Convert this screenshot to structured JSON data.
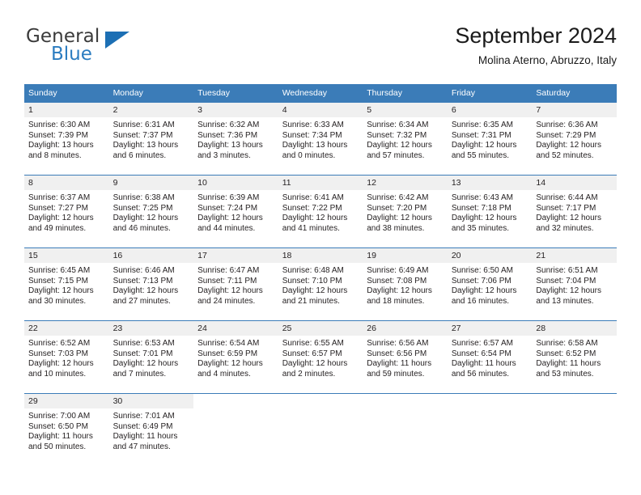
{
  "brand": {
    "name_part1": "General",
    "name_part2": "Blue",
    "triangle_color": "#1c6fb4",
    "blue_text_color": "#2b7cc0"
  },
  "header": {
    "title": "September 2024",
    "subtitle": "Molina Aterno, Abruzzo, Italy"
  },
  "theme": {
    "header_blue": "#3b7cb8",
    "daynum_band": "#f0f0f0",
    "text": "#231f20"
  },
  "weekday_headers": [
    "Sunday",
    "Monday",
    "Tuesday",
    "Wednesday",
    "Thursday",
    "Friday",
    "Saturday"
  ],
  "weeks": [
    [
      {
        "day": "1",
        "sunrise": "Sunrise: 6:30 AM",
        "sunset": "Sunset: 7:39 PM",
        "daylight_line1": "Daylight: 13 hours",
        "daylight_line2": "and 8 minutes."
      },
      {
        "day": "2",
        "sunrise": "Sunrise: 6:31 AM",
        "sunset": "Sunset: 7:37 PM",
        "daylight_line1": "Daylight: 13 hours",
        "daylight_line2": "and 6 minutes."
      },
      {
        "day": "3",
        "sunrise": "Sunrise: 6:32 AM",
        "sunset": "Sunset: 7:36 PM",
        "daylight_line1": "Daylight: 13 hours",
        "daylight_line2": "and 3 minutes."
      },
      {
        "day": "4",
        "sunrise": "Sunrise: 6:33 AM",
        "sunset": "Sunset: 7:34 PM",
        "daylight_line1": "Daylight: 13 hours",
        "daylight_line2": "and 0 minutes."
      },
      {
        "day": "5",
        "sunrise": "Sunrise: 6:34 AM",
        "sunset": "Sunset: 7:32 PM",
        "daylight_line1": "Daylight: 12 hours",
        "daylight_line2": "and 57 minutes."
      },
      {
        "day": "6",
        "sunrise": "Sunrise: 6:35 AM",
        "sunset": "Sunset: 7:31 PM",
        "daylight_line1": "Daylight: 12 hours",
        "daylight_line2": "and 55 minutes."
      },
      {
        "day": "7",
        "sunrise": "Sunrise: 6:36 AM",
        "sunset": "Sunset: 7:29 PM",
        "daylight_line1": "Daylight: 12 hours",
        "daylight_line2": "and 52 minutes."
      }
    ],
    [
      {
        "day": "8",
        "sunrise": "Sunrise: 6:37 AM",
        "sunset": "Sunset: 7:27 PM",
        "daylight_line1": "Daylight: 12 hours",
        "daylight_line2": "and 49 minutes."
      },
      {
        "day": "9",
        "sunrise": "Sunrise: 6:38 AM",
        "sunset": "Sunset: 7:25 PM",
        "daylight_line1": "Daylight: 12 hours",
        "daylight_line2": "and 46 minutes."
      },
      {
        "day": "10",
        "sunrise": "Sunrise: 6:39 AM",
        "sunset": "Sunset: 7:24 PM",
        "daylight_line1": "Daylight: 12 hours",
        "daylight_line2": "and 44 minutes."
      },
      {
        "day": "11",
        "sunrise": "Sunrise: 6:41 AM",
        "sunset": "Sunset: 7:22 PM",
        "daylight_line1": "Daylight: 12 hours",
        "daylight_line2": "and 41 minutes."
      },
      {
        "day": "12",
        "sunrise": "Sunrise: 6:42 AM",
        "sunset": "Sunset: 7:20 PM",
        "daylight_line1": "Daylight: 12 hours",
        "daylight_line2": "and 38 minutes."
      },
      {
        "day": "13",
        "sunrise": "Sunrise: 6:43 AM",
        "sunset": "Sunset: 7:18 PM",
        "daylight_line1": "Daylight: 12 hours",
        "daylight_line2": "and 35 minutes."
      },
      {
        "day": "14",
        "sunrise": "Sunrise: 6:44 AM",
        "sunset": "Sunset: 7:17 PM",
        "daylight_line1": "Daylight: 12 hours",
        "daylight_line2": "and 32 minutes."
      }
    ],
    [
      {
        "day": "15",
        "sunrise": "Sunrise: 6:45 AM",
        "sunset": "Sunset: 7:15 PM",
        "daylight_line1": "Daylight: 12 hours",
        "daylight_line2": "and 30 minutes."
      },
      {
        "day": "16",
        "sunrise": "Sunrise: 6:46 AM",
        "sunset": "Sunset: 7:13 PM",
        "daylight_line1": "Daylight: 12 hours",
        "daylight_line2": "and 27 minutes."
      },
      {
        "day": "17",
        "sunrise": "Sunrise: 6:47 AM",
        "sunset": "Sunset: 7:11 PM",
        "daylight_line1": "Daylight: 12 hours",
        "daylight_line2": "and 24 minutes."
      },
      {
        "day": "18",
        "sunrise": "Sunrise: 6:48 AM",
        "sunset": "Sunset: 7:10 PM",
        "daylight_line1": "Daylight: 12 hours",
        "daylight_line2": "and 21 minutes."
      },
      {
        "day": "19",
        "sunrise": "Sunrise: 6:49 AM",
        "sunset": "Sunset: 7:08 PM",
        "daylight_line1": "Daylight: 12 hours",
        "daylight_line2": "and 18 minutes."
      },
      {
        "day": "20",
        "sunrise": "Sunrise: 6:50 AM",
        "sunset": "Sunset: 7:06 PM",
        "daylight_line1": "Daylight: 12 hours",
        "daylight_line2": "and 16 minutes."
      },
      {
        "day": "21",
        "sunrise": "Sunrise: 6:51 AM",
        "sunset": "Sunset: 7:04 PM",
        "daylight_line1": "Daylight: 12 hours",
        "daylight_line2": "and 13 minutes."
      }
    ],
    [
      {
        "day": "22",
        "sunrise": "Sunrise: 6:52 AM",
        "sunset": "Sunset: 7:03 PM",
        "daylight_line1": "Daylight: 12 hours",
        "daylight_line2": "and 10 minutes."
      },
      {
        "day": "23",
        "sunrise": "Sunrise: 6:53 AM",
        "sunset": "Sunset: 7:01 PM",
        "daylight_line1": "Daylight: 12 hours",
        "daylight_line2": "and 7 minutes."
      },
      {
        "day": "24",
        "sunrise": "Sunrise: 6:54 AM",
        "sunset": "Sunset: 6:59 PM",
        "daylight_line1": "Daylight: 12 hours",
        "daylight_line2": "and 4 minutes."
      },
      {
        "day": "25",
        "sunrise": "Sunrise: 6:55 AM",
        "sunset": "Sunset: 6:57 PM",
        "daylight_line1": "Daylight: 12 hours",
        "daylight_line2": "and 2 minutes."
      },
      {
        "day": "26",
        "sunrise": "Sunrise: 6:56 AM",
        "sunset": "Sunset: 6:56 PM",
        "daylight_line1": "Daylight: 11 hours",
        "daylight_line2": "and 59 minutes."
      },
      {
        "day": "27",
        "sunrise": "Sunrise: 6:57 AM",
        "sunset": "Sunset: 6:54 PM",
        "daylight_line1": "Daylight: 11 hours",
        "daylight_line2": "and 56 minutes."
      },
      {
        "day": "28",
        "sunrise": "Sunrise: 6:58 AM",
        "sunset": "Sunset: 6:52 PM",
        "daylight_line1": "Daylight: 11 hours",
        "daylight_line2": "and 53 minutes."
      }
    ],
    [
      {
        "day": "29",
        "sunrise": "Sunrise: 7:00 AM",
        "sunset": "Sunset: 6:50 PM",
        "daylight_line1": "Daylight: 11 hours",
        "daylight_line2": "and 50 minutes."
      },
      {
        "day": "30",
        "sunrise": "Sunrise: 7:01 AM",
        "sunset": "Sunset: 6:49 PM",
        "daylight_line1": "Daylight: 11 hours",
        "daylight_line2": "and 47 minutes."
      },
      {
        "day": "",
        "sunrise": "",
        "sunset": "",
        "daylight_line1": "",
        "daylight_line2": ""
      },
      {
        "day": "",
        "sunrise": "",
        "sunset": "",
        "daylight_line1": "",
        "daylight_line2": ""
      },
      {
        "day": "",
        "sunrise": "",
        "sunset": "",
        "daylight_line1": "",
        "daylight_line2": ""
      },
      {
        "day": "",
        "sunrise": "",
        "sunset": "",
        "daylight_line1": "",
        "daylight_line2": ""
      },
      {
        "day": "",
        "sunrise": "",
        "sunset": "",
        "daylight_line1": "",
        "daylight_line2": ""
      }
    ]
  ]
}
